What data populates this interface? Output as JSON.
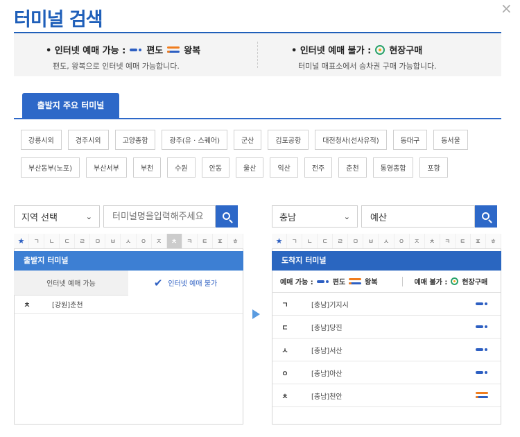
{
  "title": "터미널 검색",
  "close_label": "×",
  "legend": {
    "left": {
      "head_prefix": "• 인터넷 예매 가능 :",
      "oneway": "편도",
      "round": "왕복",
      "sub": "편도, 왕복으로 인터넷 예매 가능합니다."
    },
    "right": {
      "head_prefix": "• 인터넷 예매 불가 :",
      "site": "현장구매",
      "sub": "터미널 매표소에서 승차권 구매 가능합니다."
    }
  },
  "major_tab": "출발지 주요 터미널",
  "major_terminals": [
    [
      "강릉시외",
      "경주시외",
      "고양종합",
      "광주(유 · 스퀘어)",
      "군산",
      "김포공항",
      "대전청사(선사유적)",
      "동대구",
      "동서울"
    ],
    [
      "부산동부(노포)",
      "부산서부",
      "부천",
      "수원",
      "안동",
      "울산",
      "익산",
      "전주",
      "춘천",
      "통영종합",
      "포항"
    ]
  ],
  "departure": {
    "region_select": "지역 선택",
    "input_placeholder": "터미널명을입력해주세요",
    "consonants": [
      "★",
      "ㄱ",
      "ㄴ",
      "ㄷ",
      "ㄹ",
      "ㅁ",
      "ㅂ",
      "ㅅ",
      "ㅇ",
      "ㅈ",
      "ㅊ",
      "ㅋ",
      "ㅌ",
      "ㅍ",
      "ㅎ"
    ],
    "active_consonant": 10,
    "header": "출발지 터미널",
    "tabs": [
      "인터넷 예매 가능",
      "인터넷 예매 불가"
    ],
    "active_tab": 1,
    "check": "✔",
    "rows": [
      {
        "cons": "ㅊ",
        "name": "[강원]춘천"
      }
    ]
  },
  "arrival": {
    "region_select": "충남",
    "input_value": "예산",
    "consonants": [
      "★",
      "ㄱ",
      "ㄴ",
      "ㄷ",
      "ㄹ",
      "ㅁ",
      "ㅂ",
      "ㅅ",
      "ㅇ",
      "ㅈ",
      "ㅊ",
      "ㅋ",
      "ㅌ",
      "ㅍ",
      "ㅎ"
    ],
    "header": "도착지 터미널",
    "legend": {
      "can_label": "예매 가능 :",
      "oneway": "편도",
      "round": "왕복",
      "cannot_label": "예매 불가 :",
      "site": "현장구매"
    },
    "rows": [
      {
        "cons": "ㄱ",
        "name": "[충남]기지시",
        "type": "oneway"
      },
      {
        "cons": "ㄷ",
        "name": "[충남]당진",
        "type": "oneway"
      },
      {
        "cons": "ㅅ",
        "name": "[충남]서산",
        "type": "oneway"
      },
      {
        "cons": "ㅇ",
        "name": "[충남]아산",
        "type": "oneway"
      },
      {
        "cons": "ㅊ",
        "name": "[충남]천안",
        "type": "round"
      }
    ]
  },
  "colors": {
    "primary": "#1f5fb9",
    "header": "#3d7fd3",
    "oneway": "#2d5fc2",
    "round": "#f07d1e",
    "site": "#2aa36b"
  }
}
